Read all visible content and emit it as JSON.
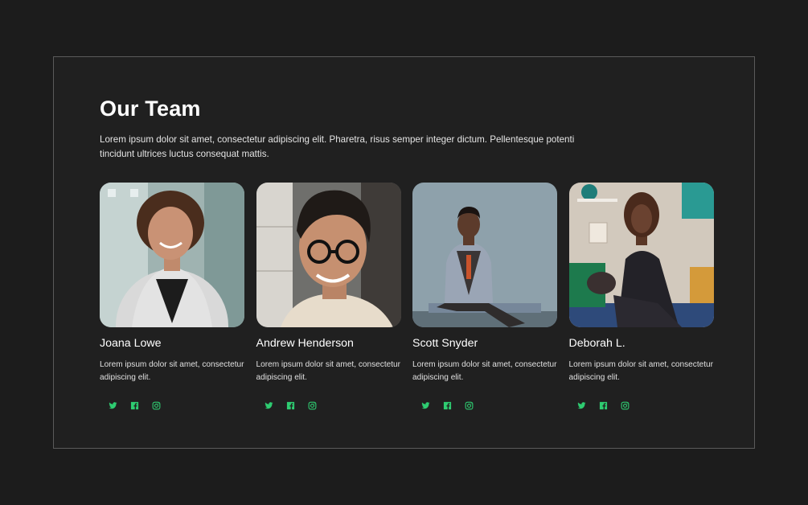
{
  "section": {
    "title": "Our Team",
    "description": "Lorem ipsum dolor sit amet, consectetur adipiscing elit. Pharetra, risus semper integer dictum. Pellentesque potenti tincidunt ultrices luctus consequat mattis."
  },
  "accent_color": "#2ecc71",
  "members": [
    {
      "name": "Joana Lowe",
      "bio": "Lorem ipsum dolor sit amet, consectetur adipiscing elit.",
      "photo_alt": "Portrait of Joana Lowe"
    },
    {
      "name": "Andrew Henderson",
      "bio": "Lorem ipsum dolor sit amet, consectetur adipiscing elit.",
      "photo_alt": "Portrait of Andrew Henderson"
    },
    {
      "name": "Scott Snyder",
      "bio": "Lorem ipsum dolor sit amet, consectetur adipiscing elit.",
      "photo_alt": "Portrait of Scott Snyder"
    },
    {
      "name": "Deborah L.",
      "bio": "Lorem ipsum dolor sit amet, consectetur adipiscing elit.",
      "photo_alt": "Portrait of Deborah L."
    }
  ],
  "social_icons": [
    "twitter-icon",
    "facebook-icon",
    "instagram-icon"
  ]
}
